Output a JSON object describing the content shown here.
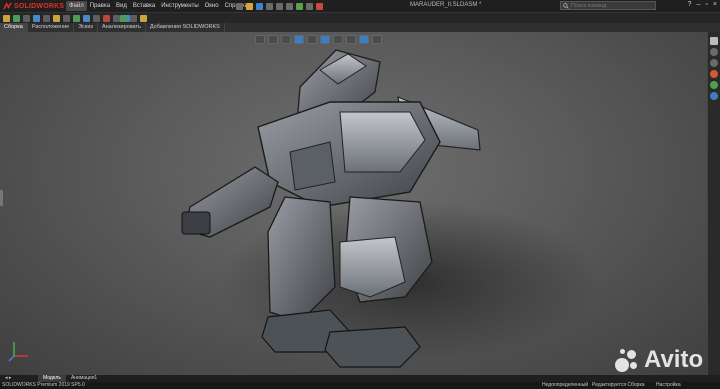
{
  "app": {
    "logo_text": "SOLIDWORKS",
    "menu": [
      "Файл",
      "Правка",
      "Вид",
      "Вставка",
      "Инструменты",
      "Окно",
      "Справка"
    ],
    "document_title": "MARAUDER_II.SLDASM *",
    "search_placeholder": "Поиск команд"
  },
  "command_tabs": [
    "Сборка",
    "Расположение",
    "Эскиз",
    "Анализировать",
    "Добавления SOLIDWORKS"
  ],
  "active_command_tab": "Сборка",
  "viewport": {
    "model": "mech robot 3D assembly",
    "background": "#5a5a5a"
  },
  "bottom_tabs": [
    "Модель",
    "Анимация1"
  ],
  "active_bottom_tab": "Модель",
  "status": {
    "version": "SOLIDWORKS Premium 2019 SP5.0",
    "state": "Недоопределенный",
    "mode": "Редактируется Сборка",
    "settings": "Настройка"
  },
  "watermark": "Avito",
  "colors": {
    "logo": "#e03127",
    "accent_blue": "#3d86c6"
  }
}
